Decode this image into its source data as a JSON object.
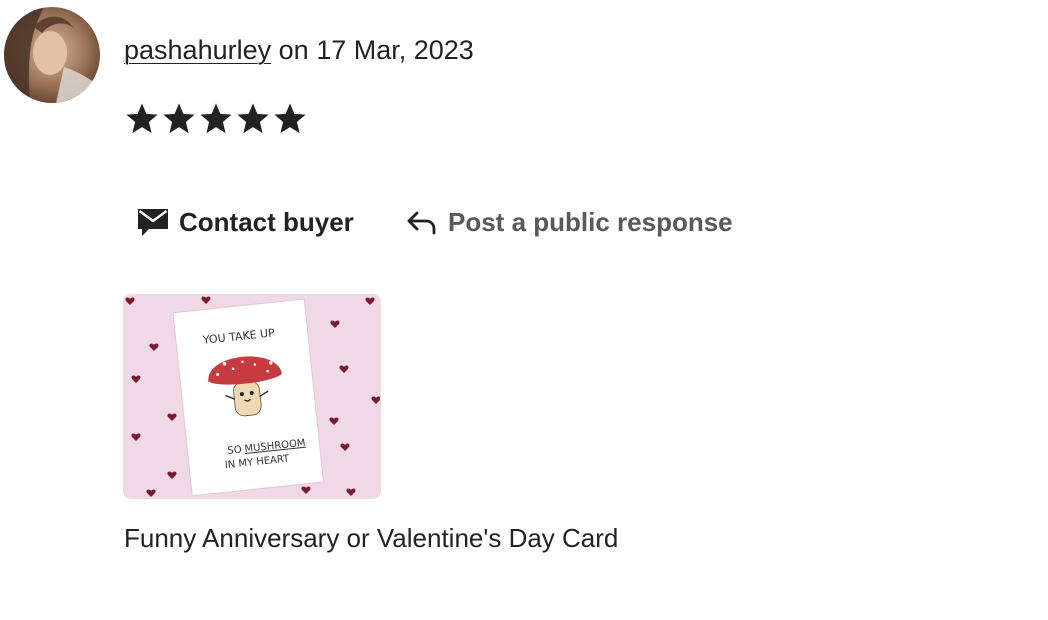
{
  "review": {
    "username": "pashahurley",
    "date_prefix": "on",
    "date": "17 Mar, 2023",
    "rating": 5,
    "rating_max": 5
  },
  "actions": {
    "contact_label": "Contact buyer",
    "contact_icon": "envelope-icon",
    "public_response_label": "Post a public response",
    "public_response_icon": "reply-arrow-icon"
  },
  "listing": {
    "title": "Funny Anniversary or Valentine's Day Card",
    "image_text": {
      "top_line": "YOU TAKE UP",
      "bottom_line_1a": "SO",
      "bottom_line_1b": "MUSHROOM",
      "bottom_line_2": "IN MY HEART"
    }
  },
  "colors": {
    "text": "#222222",
    "muted": "#595959",
    "thumb_bg": "#f0d8e6",
    "mushroom_cap": "#c63b3f",
    "heart": "#7a1a2e"
  }
}
